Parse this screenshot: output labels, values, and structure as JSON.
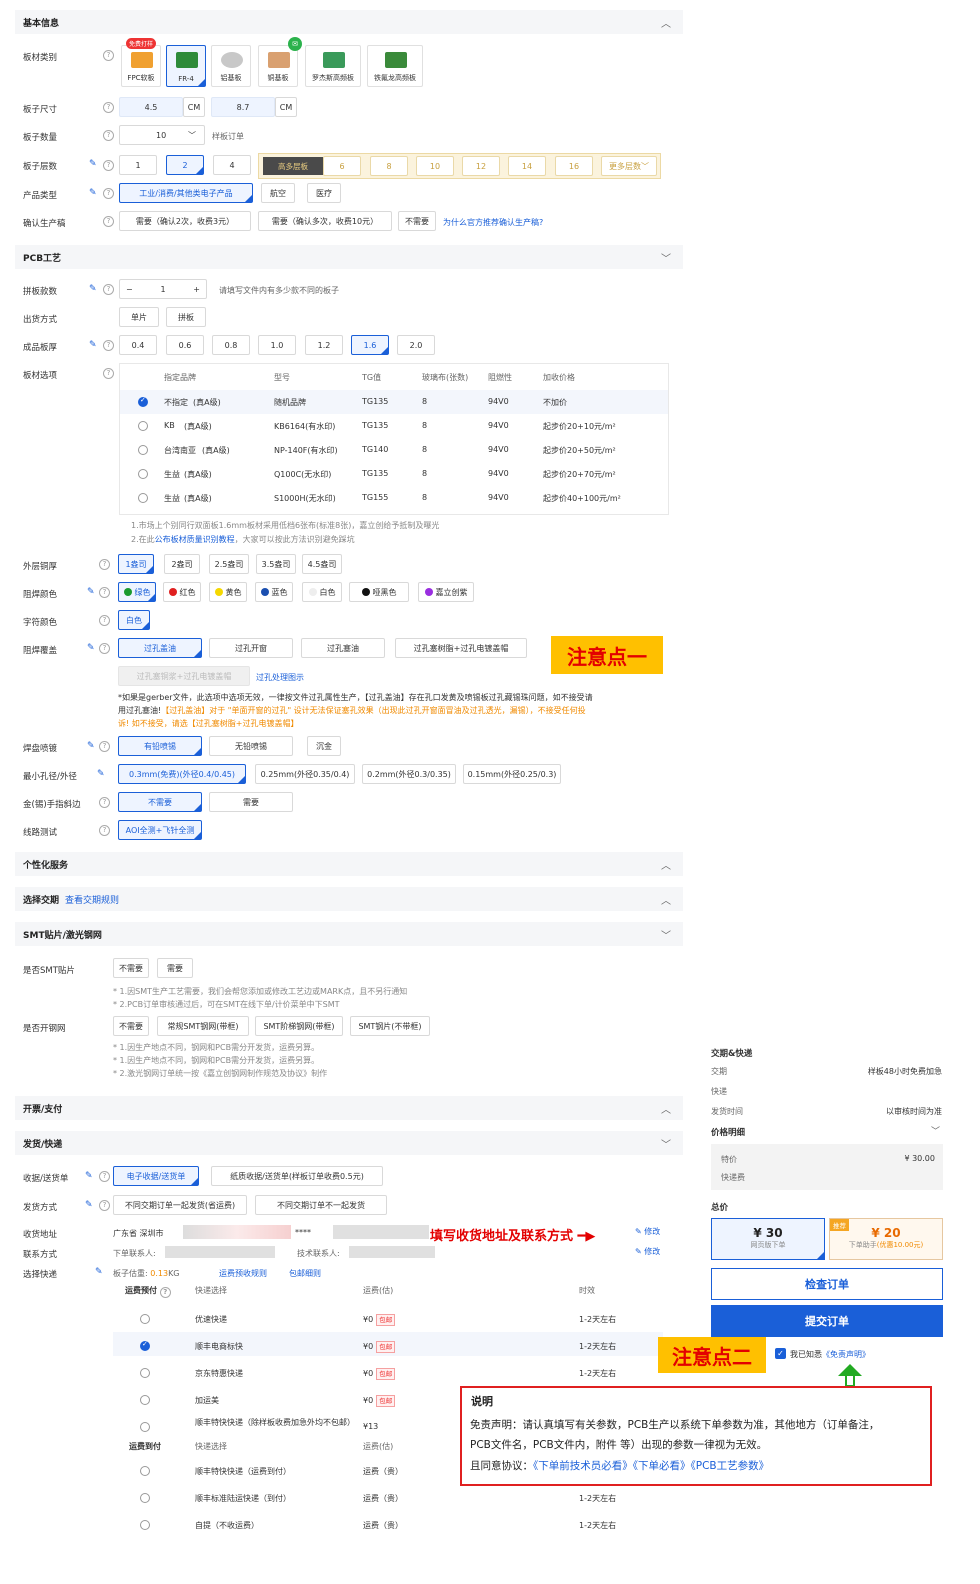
{
  "basic": {
    "title": "基本信息",
    "board_type_label": "板材类别",
    "board_types": [
      {
        "label": "FPC软板",
        "badge": "免费打样"
      },
      {
        "label": "FR-4"
      },
      {
        "label": "铝基板"
      },
      {
        "label": "铜基板"
      },
      {
        "label": "罗杰斯高频板"
      },
      {
        "label": "铁氟龙高频板"
      }
    ],
    "size_label": "板子尺寸",
    "width": "4.5",
    "height": "8.7",
    "unit": "CM",
    "qty_label": "板子数量",
    "qty": "10",
    "qty_hint": "样板订单",
    "layers_label": "板子层数",
    "layers": [
      "1",
      "2",
      "4"
    ],
    "multi_label": "高多层板",
    "multi_layers": [
      "6",
      "8",
      "10",
      "12",
      "14",
      "16"
    ],
    "more_layers": "更多层数",
    "product_label": "产品类型",
    "products": [
      "工业/消费/其他类电子产品",
      "航空",
      "医疗"
    ],
    "confirm_label": "确认生产稿",
    "confirm_opts": [
      "需要（确认2次，收费3元）",
      "需要（确认多次，收费10元）",
      "不需要"
    ],
    "confirm_link": "为什么官方推荐确认生产稿?"
  },
  "pcb": {
    "title": "PCB工艺",
    "panel_label": "拼板款数",
    "panel_qty": "1",
    "panel_hint": "请填写文件内有多少款不同的板子",
    "ship_label": "出货方式",
    "ship_opts": [
      "单片",
      "拼板"
    ],
    "thick_label": "成品板厚",
    "thick": [
      "0.4",
      "0.6",
      "0.8",
      "1.0",
      "1.2",
      "1.6",
      "2.0"
    ],
    "mat_label": "板材选项",
    "mat_headers": [
      "指定品牌",
      "型号",
      "TG值",
      "玻璃布(张数)",
      "阻燃性",
      "加收价格"
    ],
    "mat_rows": [
      {
        "brand": "不指定",
        "grade": "(真A级)",
        "model": "随机品牌",
        "tg": "TG135",
        "cloth": "8",
        "flame": "94V0",
        "price": "不加价"
      },
      {
        "brand": "KB",
        "grade": "(真A级)",
        "model": "KB6164(有水印)",
        "tg": "TG135",
        "cloth": "8",
        "flame": "94V0",
        "price": "起步价20+10元/m²"
      },
      {
        "brand": "台湾南亚",
        "grade": "(真A级)",
        "model": "NP-140F(有水印)",
        "tg": "TG140",
        "cloth": "8",
        "flame": "94V0",
        "price": "起步价20+50元/m²"
      },
      {
        "brand": "生益",
        "grade": "(真A级)",
        "model": "Q100C(无水印)",
        "tg": "TG135",
        "cloth": "8",
        "flame": "94V0",
        "price": "起步价20+70元/m²"
      },
      {
        "brand": "生益",
        "grade": "(真A级)",
        "model": "S1000H(无水印)",
        "tg": "TG155",
        "cloth": "8",
        "flame": "94V0",
        "price": "起步价40+100元/m²"
      }
    ],
    "mat_note1": "1.市场上个别同行双面板1.6mm板材采用低档6张布(标准8张)，嘉立创给予抵制及曝光",
    "mat_note2a": "2.在此",
    "mat_note2_link": "公布板材质量识别教程",
    "mat_note2b": "，大家可以按此方法识别避免踩坑",
    "copper_label": "外层铜厚",
    "copper": [
      "1盎司",
      "2盎司",
      "2.5盎司",
      "3.5盎司",
      "4.5盎司"
    ],
    "mask_label": "阻焊颜色",
    "mask": [
      {
        "label": "绿色",
        "color": "#1a9a2e"
      },
      {
        "label": "红色",
        "color": "#e02020"
      },
      {
        "label": "黄色",
        "color": "#f5d800"
      },
      {
        "label": "蓝色",
        "color": "#1a4fb0"
      },
      {
        "label": "白色",
        "color": "#eeeeee"
      },
      {
        "label": "哑黑色",
        "color": "#111111"
      },
      {
        "label": "嘉立创紫",
        "color": "#9a2ee0"
      }
    ],
    "silk_label": "字符颜色",
    "silk": "白色",
    "via_label": "阻焊覆盖",
    "via": [
      "过孔盖油",
      "过孔开窗",
      "过孔塞油",
      "过孔塞树脂+过孔电镀盖帽"
    ],
    "via_dis": "过孔塞铜浆+过孔电镀盖帽",
    "via_link": "过孔处理图示",
    "via_note1": "*如果是gerber文件，此选项中选项无效，一律按文件过孔属性生产，【过孔盖油】存在孔口发黄及喷锡板过孔藏锡珠问题，如不接受请",
    "via_note2a": "用过孔塞油!",
    "via_note2b": "【过孔盖油】对于 \"单面开窗的过孔\" 设计无法保证塞孔效果（出现此过孔开窗面冒油及过孔透光，漏锡），不接受任何投",
    "via_note3": "诉! 如不接受，请选【过孔塞树脂+过孔电镀盖帽】",
    "finish_label": "焊盘喷镀",
    "finish": [
      "有铅喷锡",
      "无铅喷锡",
      "沉金"
    ],
    "hole_label": "最小孔径/外径",
    "holes": [
      "0.3mm(免费)(外径0.4/0.45)",
      "0.25mm(外径0.35/0.4)",
      "0.2mm(外径0.3/0.35)",
      "0.15mm(外径0.25/0.3)"
    ],
    "bevel_label": "金(锡)手指斜边",
    "bevel": [
      "不需要",
      "需要"
    ],
    "test_label": "线路测试",
    "test": "AOI全测+飞针全测"
  },
  "annot1": "注意点一",
  "annot2": "注意点二",
  "personal": {
    "title": "个性化服务"
  },
  "delivery_sec": {
    "title": "选择交期",
    "link": "查看交期规则"
  },
  "smt": {
    "title": "SMT贴片/激光钢网",
    "smt_label": "是否SMT贴片",
    "smt_opts": [
      "不需要",
      "需要"
    ],
    "smt_note1": "* 1.因SMT生产工艺需要，我们会帮您添加或修改工艺边或MARK点，且不另行通知",
    "smt_note2": "* 2.PCB订单审核通过后，可在SMT在线下单/计价菜单中下SMT",
    "stencil_label": "是否开钢网",
    "stencil_opts": [
      "不需要",
      "常规SMT钢网(带框)",
      "SMT阶梯钢网(带框)",
      "SMT钢片(不带框)"
    ],
    "st_note1": "* 1.因生产地点不同，钢网和PCB需分开发货，运费另算。",
    "st_note2": "* 1.因生产地点不同，钢网和PCB需分开发货，运费另算。",
    "st_note3": "* 2.激光钢网订单统一按《嘉立创钢网制作规范及协议》制作"
  },
  "invoice": {
    "title": "开票/支付"
  },
  "ship": {
    "title": "发货/快递",
    "receipt_label": "收据/送货单",
    "receipt": [
      "电子收据/送货单",
      "纸质收据/送货单(样板订单收费0.5元)"
    ],
    "mode_label": "发货方式",
    "mode": [
      "不同交期订单一起发货(省运费)",
      "不同交期订单不一起发货"
    ],
    "addr_label": "收货地址",
    "addr": "广东省  深圳市",
    "addr_tail": "****",
    "contact_label": "联系方式",
    "contact_a": "下单联系人:",
    "contact_b": "技术联系人:",
    "edit": "修改",
    "annot_text": "填写收货地址及联系方式",
    "express_label": "选择快递",
    "weight_label": "板子估重:",
    "weight": "0.13",
    "weight_unit": "KG",
    "rule_link": "运费预收规则",
    "pack_link": "包邮细则",
    "prepay_label": "运费预付",
    "col_express": "快递选择",
    "col_fee": "运费(估)",
    "col_time": "时效",
    "prepay_rows": [
      {
        "name": "优速快递",
        "fee": "¥0",
        "tag": "包邮",
        "time": "1-2天左右"
      },
      {
        "name": "顺丰电商标快",
        "fee": "¥0",
        "tag": "包邮",
        "time": "1-2天左右"
      },
      {
        "name": "京东特惠快递",
        "fee": "¥0",
        "tag": "包邮",
        "time": "1-2天左右"
      },
      {
        "name": "加运美",
        "fee": "¥0",
        "tag": "包邮",
        "time": "1-2天左右"
      },
      {
        "name": "顺丰特快快递（除样板收费加急外均不包邮）",
        "fee": "¥13",
        "tag": "",
        "time": ""
      }
    ],
    "cod_label": "运费到付",
    "cod_rows": [
      {
        "name": "顺丰特快快递（运费到付）",
        "fee": "运费（贵）",
        "time": ""
      },
      {
        "name": "顺丰标准陆运快递（到付）",
        "fee": "运费（贵）",
        "time": "1-2天左右"
      },
      {
        "name": "自提（不收运费）",
        "fee": "运费（贵）",
        "time": "1-2天左右"
      }
    ]
  },
  "side": {
    "deliv_title": "交期&快递",
    "deliv_label": "交期",
    "deliv_val": "样板48小时免费加急",
    "express_label": "快递",
    "ship_time_label": "发货时间",
    "ship_time_val": "以审核时间为准",
    "price_title": "价格明细",
    "pcb_fee_label": "特价",
    "pcb_fee": "¥ 30.00",
    "ship_fee_label": "快递费",
    "total_title": "总价",
    "total1": "¥ 30",
    "total1_sub": "网页版下单",
    "total2": "¥ 20",
    "total2_badge": "推荐",
    "total2_sub": "下单助手",
    "total2_sub2": "(优惠10.00元)",
    "check_btn": "检查订单",
    "submit_btn": "提交订单",
    "agree": "我已知悉",
    "agree_link": "《免责声明》"
  },
  "disclaimer": {
    "title": "说明",
    "line1": "免责声明：请认真填写有关参数，PCB生产以系统下单参数为准，其他地方（订单备注，",
    "line2": "PCB文件名，PCB文件内，附件 等）出现的参数一律视为无效。",
    "line3a": "且同意协议：",
    "links": [
      "《下单前技术员必看》",
      "《下单必看》",
      "《PCB工艺参数》"
    ]
  }
}
